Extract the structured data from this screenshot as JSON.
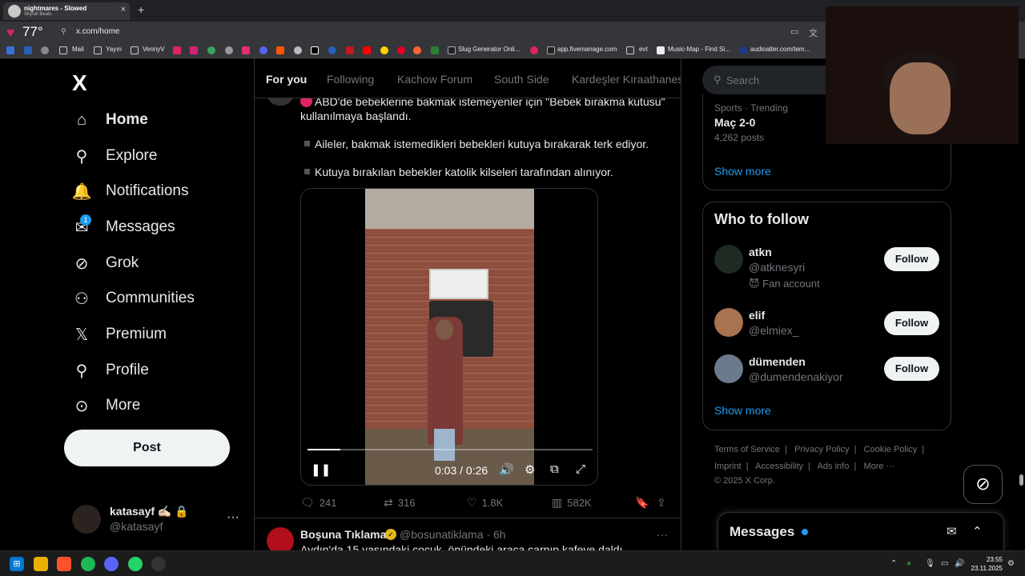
{
  "browser": {
    "tab": {
      "title": "nightmares - Slowed",
      "subtitle": "Skyfall Beats"
    },
    "new_tab": "+",
    "close": "×",
    "temperature": "77",
    "url": "x.com/home",
    "bookmarks": [
      {
        "label": "Mail"
      },
      {
        "label": "Yayın"
      },
      {
        "label": "VennyV"
      },
      {
        "label": "Slug Generator Onli..."
      },
      {
        "label": "app.fivemanage.com"
      },
      {
        "label": "evt"
      },
      {
        "label": "Music-Map - Find Si..."
      },
      {
        "label": "audioalter.com/tem..."
      }
    ]
  },
  "sidebar": {
    "logo": "X",
    "items": [
      {
        "label": "Home",
        "icon": "home-icon"
      },
      {
        "label": "Explore",
        "icon": "search-icon"
      },
      {
        "label": "Notifications",
        "icon": "bell-icon"
      },
      {
        "label": "Messages",
        "icon": "mail-icon",
        "badge": "1"
      },
      {
        "label": "Grok",
        "icon": "grok-icon"
      },
      {
        "label": "Communities",
        "icon": "communities-icon"
      },
      {
        "label": "Premium",
        "icon": "x-icon"
      },
      {
        "label": "Profile",
        "icon": "user-icon"
      },
      {
        "label": "More",
        "icon": "more-icon"
      }
    ],
    "post_label": "Post",
    "account": {
      "name": "katasayf",
      "handle": "@katasayf",
      "more": "···"
    }
  },
  "feed": {
    "tabs": [
      "For you",
      "Following",
      "Kachow Forum",
      "South Side",
      "Kardeşler Kıraathanesi"
    ],
    "tweet": {
      "text_line1": "ABD'de bebeklerine bakmak istemeyenler için \"Bebek bırakma kutusu\"",
      "text_line2": "kullanılmaya başlandı.",
      "bullet1": "Aileler, bakmak istemedikleri bebekleri kutuya bırakarak terk ediyor.",
      "bullet2": "Kutuya bırakılan bebekler katolik kilseleri tarafından alınıyor.",
      "video": {
        "time": "0:03 / 0:26",
        "progress": 0.115
      },
      "stats": {
        "replies": "241",
        "reposts": "316",
        "likes": "1.8K",
        "views": "582K"
      }
    },
    "tweet2": {
      "name": "Boşuna Tıklama",
      "handle": "@bosunatiklama",
      "time": "· 6h",
      "text": "Aydın'da 15 yaşındaki çocuk, önündeki araca çarpıp kafeye daldı"
    }
  },
  "right": {
    "search_placeholder": "Search",
    "trend": {
      "category": "Sports · Trending",
      "title": "Maç 2-0",
      "posts": "4,262 posts"
    },
    "show_more": "Show more",
    "who_to_follow_title": "Who to follow",
    "follow_label": "Follow",
    "suggestions": [
      {
        "name": "atkn",
        "handle": "@atknesyri",
        "bio": "😈 Fan account"
      },
      {
        "name": "elif",
        "handle": "@elmiex_"
      },
      {
        "name": "dümenden",
        "handle": "@dumendenakiyor"
      }
    ],
    "footer": {
      "line1": [
        "Terms of Service",
        "Privacy Policy",
        "Cookie Policy"
      ],
      "line2": [
        "Imprint",
        "Accessibility",
        "Ads info",
        "More ···"
      ],
      "copyright": "© 2025 X Corp."
    },
    "messages_drawer_title": "Messages"
  },
  "taskbar": {
    "time": "23:55",
    "date": "23.11.2025"
  },
  "colors": {
    "accent": "#1d9bf0",
    "background": "#000000",
    "border": "#2f3336",
    "muted": "#71767b"
  }
}
